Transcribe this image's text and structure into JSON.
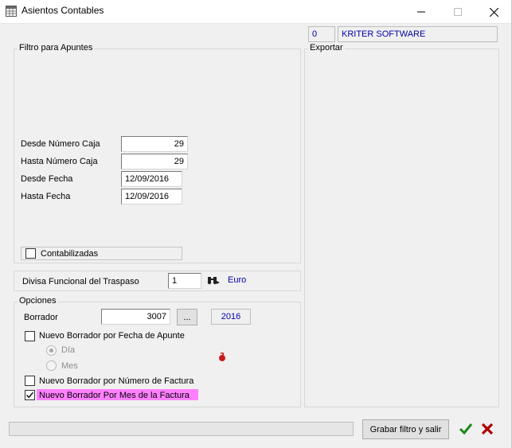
{
  "window": {
    "title": "Asientos Contables",
    "icon": "table-app-icon"
  },
  "company": {
    "code": "0",
    "name": "KRITER SOFTWARE"
  },
  "filtro": {
    "legend": "Filtro para Apuntes",
    "desde_numero_caja_label": "Desde Número Caja",
    "desde_numero_caja_value": "29",
    "hasta_numero_caja_label": "Hasta Número Caja",
    "hasta_numero_caja_value": "29",
    "desde_fecha_label": "Desde Fecha",
    "desde_fecha_value": "12/09/2016",
    "hasta_fecha_label": "Hasta Fecha",
    "hasta_fecha_value": "12/09/2016",
    "contabilizadas_label": "Contabilizadas",
    "contabilizadas_checked": false
  },
  "divisa": {
    "label": "Divisa Funcional del Traspaso",
    "value": "1",
    "currency_name": "Euro"
  },
  "opciones": {
    "legend": "Opciones",
    "borrador_label": "Borrador",
    "borrador_value": "3007",
    "browse_label": "...",
    "year": "2016",
    "nuevo_fecha_label": "Nuevo Borrador por Fecha de Apunte",
    "nuevo_fecha_checked": false,
    "radio_dia_label": "Día",
    "radio_dia_selected": true,
    "radio_mes_label": "Mes",
    "radio_mes_selected": false,
    "nuevo_factura_label": "Nuevo Borrador por Número de Factura",
    "nuevo_factura_checked": false,
    "nuevo_mes_factura_label": "Nuevo Borrador Por Mes de la Factura",
    "nuevo_mes_factura_checked": true,
    "highlight_color": "#ff80ff"
  },
  "exportar": {
    "legend": "Exportar"
  },
  "footer": {
    "grabar_label": "Grabar filtro y salir",
    "ok_color": "#1a8a1a",
    "cancel_color": "#b00000"
  }
}
